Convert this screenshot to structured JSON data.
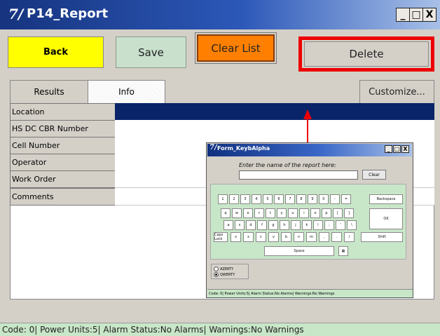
{
  "window": {
    "logo": "7/",
    "title": "P14_Report",
    "min": "_",
    "max": "□",
    "close": "X"
  },
  "toolbar": {
    "back": "Back",
    "save": "Save",
    "clear": "Clear List",
    "delete": "Delete"
  },
  "tabs": {
    "results": "Results",
    "info": "Info",
    "customize": "Customize..."
  },
  "rows": [
    {
      "label": "Location",
      "value": "",
      "selected": true
    },
    {
      "label": "HS DC CBR Number",
      "value": ""
    },
    {
      "label": "Cell Number",
      "value": ""
    },
    {
      "label": "Operator",
      "value": ""
    },
    {
      "label": "Work Order",
      "value": ""
    },
    {
      "label": "Comments",
      "value": ""
    }
  ],
  "keyboard": {
    "logo": "7/",
    "title": "Form_KeybAlpha",
    "min": "_",
    "max": "□",
    "close": "X",
    "prompt": "Enter the name of the report here:",
    "input_value": "",
    "clear": "Clear",
    "row1": [
      "1",
      "2",
      "3",
      "4",
      "5",
      "6",
      "7",
      "8",
      "9",
      "0",
      "-",
      "="
    ],
    "backspace": "Backspace",
    "row2": [
      "q",
      "w",
      "e",
      "r",
      "t",
      "y",
      "u",
      "i",
      "o",
      "p",
      "[",
      "]"
    ],
    "ok": "OK",
    "row3": [
      "a",
      "s",
      "d",
      "f",
      "g",
      "h",
      "j",
      "k",
      "l",
      ";",
      "'",
      "\\"
    ],
    "capslock": "Caps Lock",
    "row4": [
      "z",
      "x",
      "c",
      "v",
      "b",
      "n",
      "m",
      ",",
      ".",
      "/"
    ],
    "shift": "Shift",
    "space": "Space",
    "layouts": [
      "AZERTY",
      "QWERTY"
    ],
    "layout_selected": "QWERTY",
    "status": "Code: 0| Power Units:5| Alarm Status:No Alarms| Warnings:No Warnings"
  },
  "colors": {
    "back_button": "#ffff00",
    "clear_button": "#ff8000",
    "save_button": "#c8e0cc",
    "delete_highlight": "#ee0000",
    "selection": "#0a246a",
    "arrow": "#ee0000"
  },
  "status_bar": "Code: 0| Power Units:5| Alarm Status:No Alarms| Warnings:No Warnings"
}
